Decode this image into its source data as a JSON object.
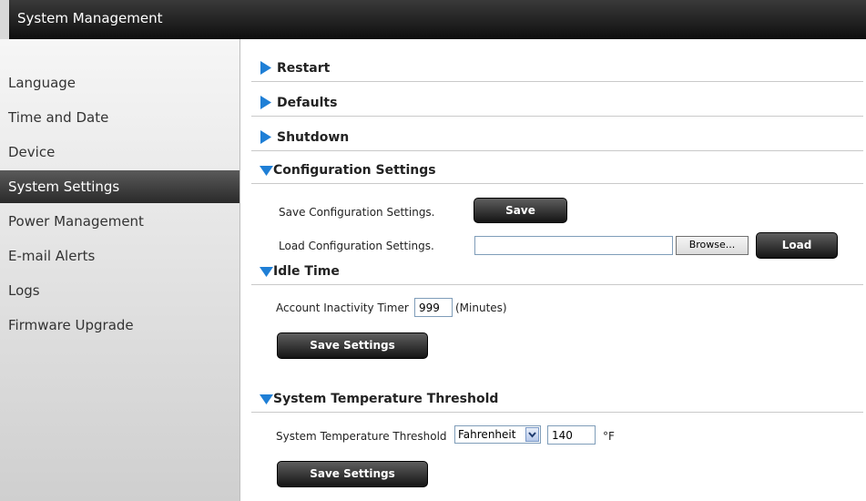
{
  "header": {
    "title": "System Management"
  },
  "sidebar": {
    "items": [
      {
        "label": "Language"
      },
      {
        "label": "Time and Date"
      },
      {
        "label": "Device"
      },
      {
        "label": "System Settings",
        "active": true
      },
      {
        "label": "Power Management"
      },
      {
        "label": "E-mail Alerts"
      },
      {
        "label": "Logs"
      },
      {
        "label": "Firmware Upgrade"
      }
    ]
  },
  "sections": {
    "restart": {
      "label": "Restart",
      "expanded": false
    },
    "defaults": {
      "label": "Defaults",
      "expanded": false
    },
    "shutdown": {
      "label": "Shutdown",
      "expanded": false
    },
    "config": {
      "label": "Configuration Settings",
      "expanded": true,
      "save_text": "Save Configuration Settings.",
      "save_button": "Save",
      "load_text": "Load Configuration Settings.",
      "file_value": "",
      "browse_button": "Browse...",
      "load_button": "Load"
    },
    "idle": {
      "label": "Idle Time",
      "expanded": true,
      "timer_label": "Account Inactivity Timer",
      "timer_value": "999",
      "unit": "(Minutes)",
      "save_button": "Save Settings"
    },
    "temp": {
      "label": "System Temperature Threshold",
      "expanded": true,
      "threshold_label": "System Temperature Threshold",
      "scale_value": "Fahrenheit",
      "threshold_value": "140",
      "unit": "°F",
      "save_button": "Save Settings"
    }
  },
  "colors": {
    "arrow": "#1f7fd6",
    "header_bg": "#0e0e0e",
    "active_nav": "#2a2a2a"
  },
  "icons": {
    "collapsed": "triangle-right-icon",
    "expanded": "triangle-down-icon",
    "dropdown": "chevron-down-icon"
  }
}
